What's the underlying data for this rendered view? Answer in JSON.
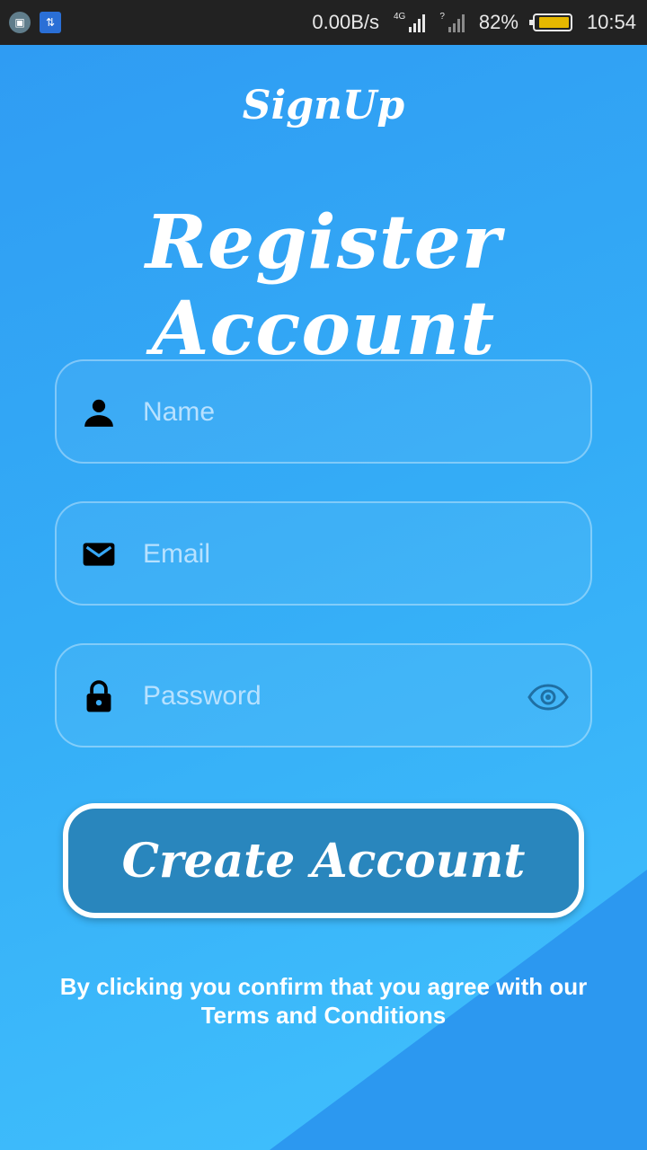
{
  "status_bar": {
    "net_speed": "0.00B/s",
    "network_type": "4G",
    "sim2_status": "?",
    "battery_percent": "82%",
    "battery_level": 0.82,
    "time": "10:54"
  },
  "appbar": {
    "title": "SignUp"
  },
  "heading": "Register Account",
  "form": {
    "name": {
      "placeholder": "Name",
      "value": ""
    },
    "email": {
      "placeholder": "Email",
      "value": ""
    },
    "password": {
      "placeholder": "Password",
      "value": ""
    }
  },
  "create_button": {
    "label": "Create Account"
  },
  "terms": {
    "line1": "By clicking you confirm that you agree with our",
    "line2": "Terms and Conditions"
  },
  "icons": {
    "name_field": "person-icon",
    "email_field": "mail-icon",
    "password_field": "lock-icon",
    "password_toggle": "eye-icon"
  },
  "colors": {
    "background": "#2f9cf3",
    "button": "#2986bd",
    "eye_icon": "#1f6fa3"
  }
}
